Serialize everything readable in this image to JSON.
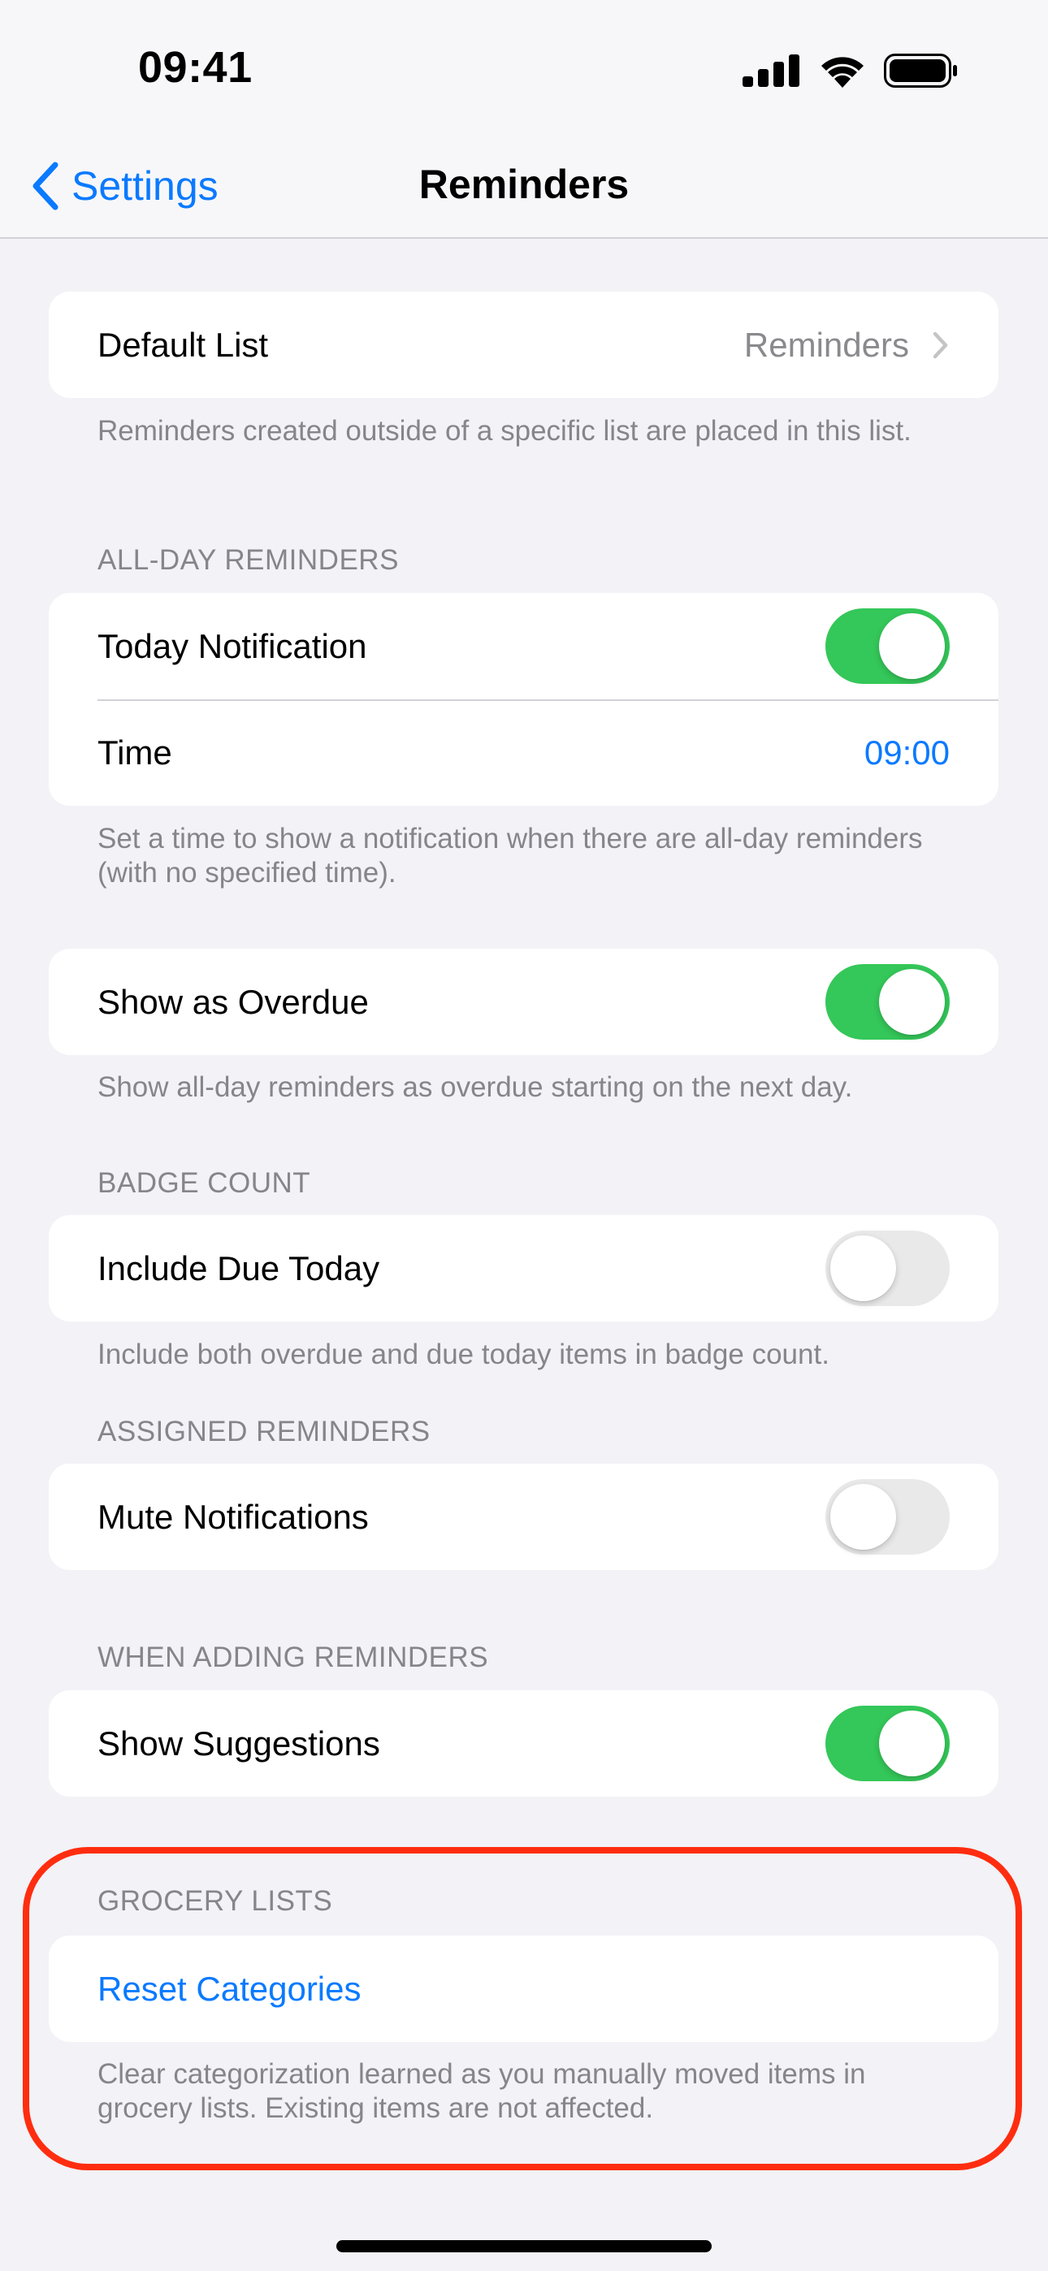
{
  "status_bar": {
    "time": "09:41",
    "icons": [
      "cellular-signal-icon",
      "wifi-icon",
      "battery-icon"
    ]
  },
  "nav": {
    "back_label": "Settings",
    "title": "Reminders"
  },
  "default_list": {
    "label": "Default List",
    "value": "Reminders",
    "footer": "Reminders created outside of a specific list are placed in this list."
  },
  "all_day": {
    "header": "ALL-DAY REMINDERS",
    "today_notification": {
      "label": "Today Notification",
      "on": true
    },
    "time": {
      "label": "Time",
      "value": "09:00"
    },
    "footer": "Set a time to show a notification when there are all-day reminders (with no specified time)."
  },
  "overdue": {
    "label": "Show as Overdue",
    "on": true,
    "footer": "Show all-day reminders as overdue starting on the next day."
  },
  "badge_count": {
    "header": "BADGE COUNT",
    "label": "Include Due Today",
    "on": false,
    "footer": "Include both overdue and due today items in badge count."
  },
  "assigned": {
    "header": "ASSIGNED REMINDERS",
    "label": "Mute Notifications",
    "on": false
  },
  "when_adding": {
    "header": "WHEN ADDING REMINDERS",
    "label": "Show Suggestions",
    "on": true
  },
  "grocery": {
    "header": "GROCERY LISTS",
    "action_label": "Reset Categories",
    "footer": "Clear categorization learned as you manually moved items in grocery lists. Existing items are not affected."
  },
  "colors": {
    "accent": "#0a7aff",
    "toggle_on": "#34c759",
    "toggle_off": "#e9e9ea",
    "highlight": "#ff2d0f",
    "background": "#f2f2f7"
  }
}
